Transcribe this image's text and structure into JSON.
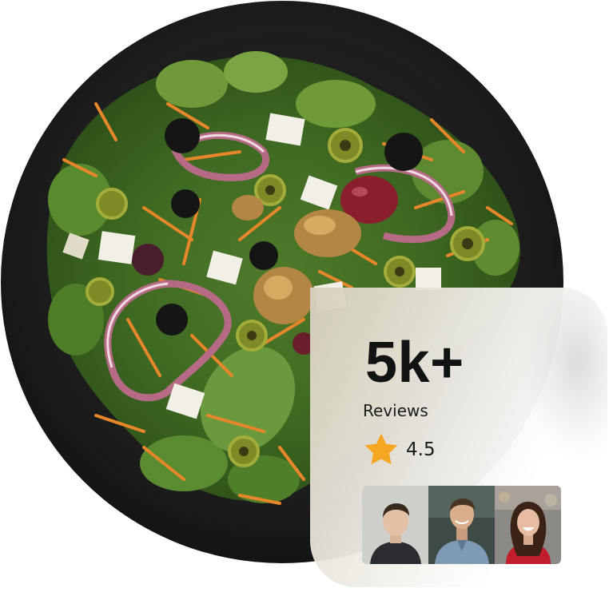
{
  "review_card": {
    "count": "5k+",
    "label": "Reviews",
    "rating": "4.5",
    "icon": "star-icon",
    "accent_color": "#F5A623"
  },
  "avatars": [
    {
      "icon": "person-avatar"
    },
    {
      "icon": "person-avatar"
    },
    {
      "icon": "person-avatar"
    }
  ]
}
